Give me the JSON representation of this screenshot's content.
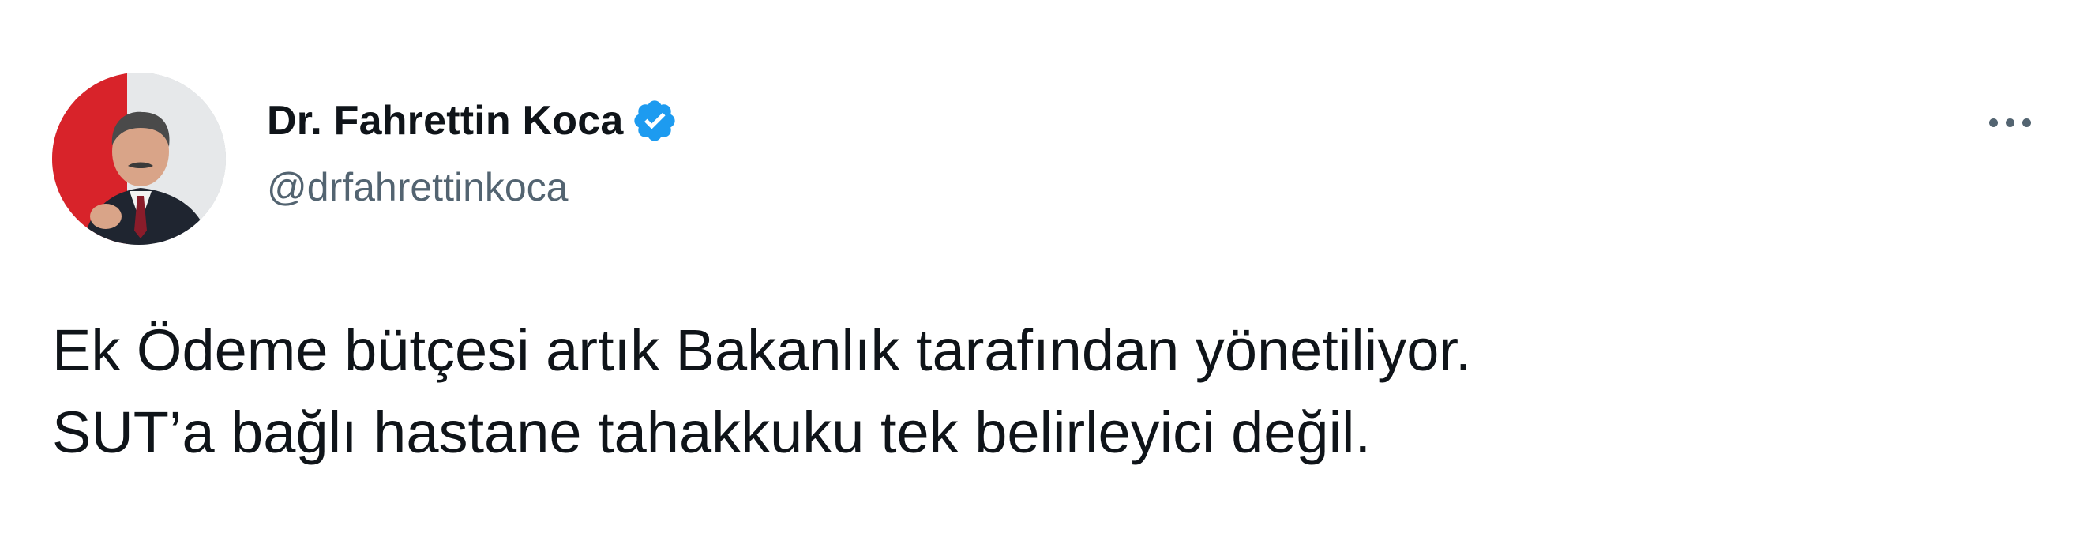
{
  "author": {
    "display_name": "Dr. Fahrettin Koca",
    "handle": "@drfahrettinkoca",
    "avatar_icon": "profile-photo",
    "verified_icon": "verified-badge-icon",
    "verified_color": "#1d9bf0"
  },
  "more_icon": "more-options-icon",
  "tweet": {
    "lines": [
      "Ek Ödeme bütçesi artık Bakanlık tarafından yönetiliyor.",
      "SUT’a bağlı hastane tahakkuku tek belirleyici değil."
    ]
  },
  "colors": {
    "text_primary": "#0f1419",
    "text_secondary": "#536471",
    "background": "#ffffff"
  }
}
